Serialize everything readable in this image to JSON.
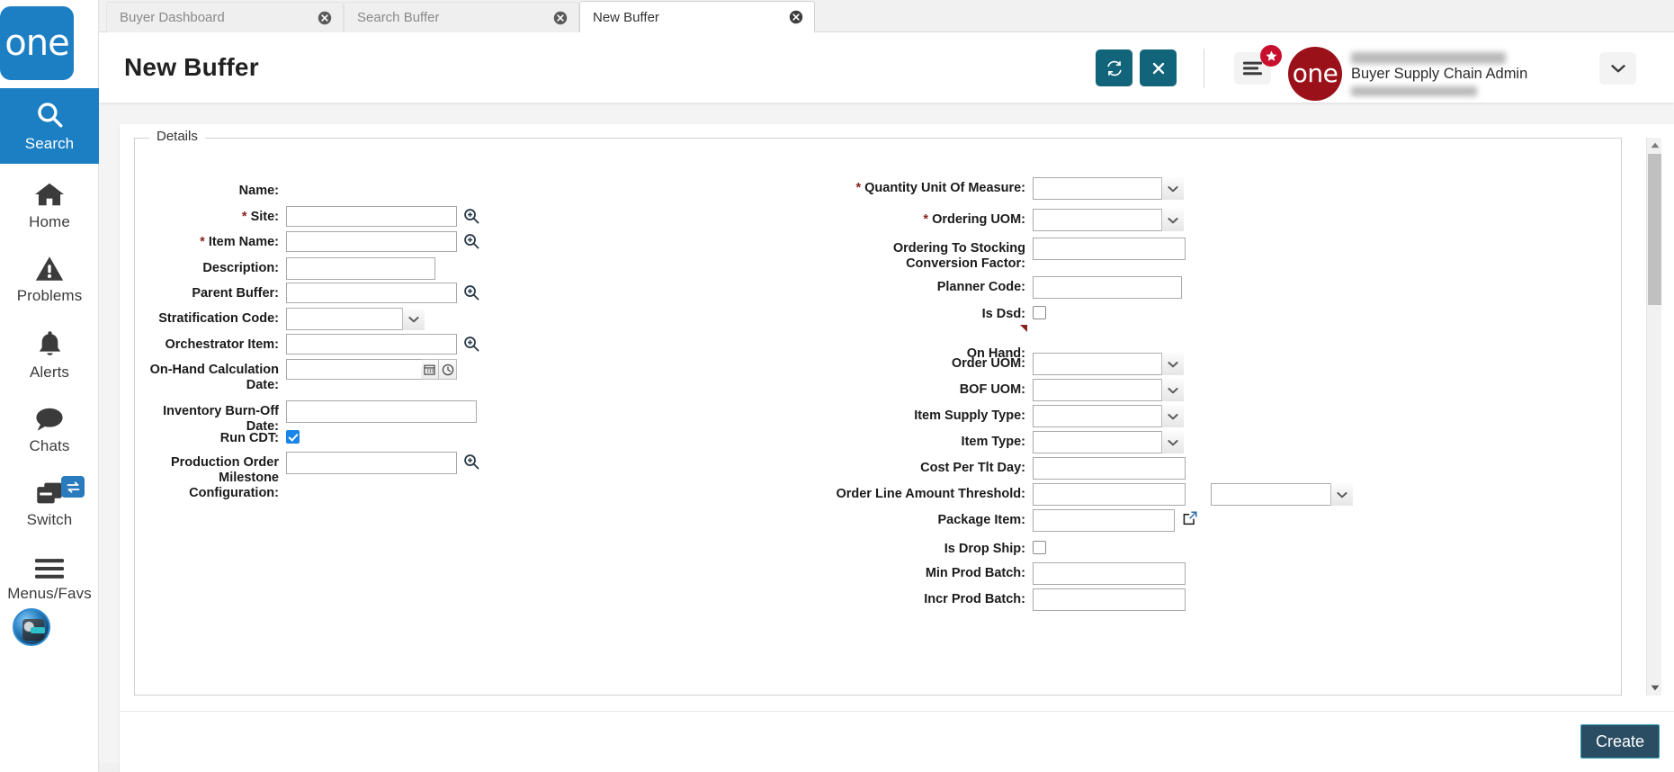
{
  "sidebar": {
    "logo_text": "one",
    "items": [
      {
        "label": "Search",
        "icon": "search-icon",
        "active": true
      },
      {
        "label": "Home",
        "icon": "home-icon",
        "active": false
      },
      {
        "label": "Problems",
        "icon": "warning-icon",
        "active": false
      },
      {
        "label": "Alerts",
        "icon": "bell-icon",
        "active": false
      },
      {
        "label": "Chats",
        "icon": "chat-icon",
        "active": false
      },
      {
        "label": "Switch",
        "icon": "switch-icon",
        "active": false
      },
      {
        "label": "Menus/Favs",
        "icon": "hamburger-icon",
        "active": false
      }
    ],
    "avatar_name": "user-avatar"
  },
  "tabs": [
    {
      "label": "Buyer Dashboard",
      "active": false,
      "closable": true
    },
    {
      "label": "Search Buffer",
      "active": false,
      "closable": true
    },
    {
      "label": "New Buffer",
      "active": true,
      "closable": true
    }
  ],
  "header": {
    "title": "New Buffer",
    "refresh_icon": "refresh-icon",
    "close_icon": "close-icon",
    "menu_icon": "hamburger-menu-icon",
    "badge_icon": "star-icon",
    "brand_text": "one",
    "user_role": "Buyer Supply Chain Admin",
    "caret_icon": "chevron-down-icon"
  },
  "details": {
    "legend": "Details",
    "left_fields": [
      {
        "label": "Name:",
        "required": false,
        "type": "text-only",
        "value": "",
        "name": "name"
      },
      {
        "label": "Site:",
        "required": true,
        "type": "lookup",
        "value": "",
        "name": "site"
      },
      {
        "label": "Item Name:",
        "required": true,
        "type": "lookup",
        "value": "",
        "name": "item-name"
      },
      {
        "label": "Description:",
        "required": false,
        "type": "text",
        "value": "",
        "name": "description"
      },
      {
        "label": "Parent Buffer:",
        "required": false,
        "type": "lookup",
        "value": "",
        "name": "parent-buffer"
      },
      {
        "label": "Stratification Code:",
        "required": false,
        "type": "select",
        "value": "",
        "name": "stratification-code"
      },
      {
        "label": "Orchestrator Item:",
        "required": false,
        "type": "lookup",
        "value": "",
        "name": "orchestrator-item"
      },
      {
        "label": "On-Hand Calculation\nDate:",
        "required": false,
        "type": "datetime",
        "value": "",
        "name": "on-hand-calculation-date"
      },
      {
        "label": "Inventory Burn-Off Date:",
        "required": false,
        "type": "text",
        "value": "",
        "name": "inventory-burn-off-date"
      },
      {
        "label": "Run CDT:",
        "required": false,
        "type": "checkbox",
        "value": true,
        "name": "run-cdt"
      },
      {
        "label": "Production Order\nMilestone Configuration:",
        "required": false,
        "type": "lookup",
        "value": "",
        "name": "production-order-milestone-configuration"
      }
    ],
    "right_fields": [
      {
        "label": "Quantity Unit Of Measure:",
        "required": true,
        "type": "select",
        "value": "",
        "name": "quantity-unit-of-measure"
      },
      {
        "label": "Ordering UOM:",
        "required": true,
        "type": "select",
        "value": "",
        "name": "ordering-uom"
      },
      {
        "label": "Ordering To Stocking\nConversion Factor:",
        "required": false,
        "type": "text",
        "value": "",
        "name": "ordering-to-stocking-conversion-factor"
      },
      {
        "label": "Planner Code:",
        "required": false,
        "type": "text",
        "value": "",
        "name": "planner-code"
      },
      {
        "label": "Is Dsd:",
        "required": false,
        "type": "checkbox",
        "value": false,
        "name": "is-dsd"
      },
      {
        "label": "On Hand:",
        "required": false,
        "type": "marked-label",
        "value": "",
        "name": "on-hand"
      },
      {
        "label": "Order UOM:",
        "required": false,
        "type": "select",
        "value": "",
        "name": "order-uom"
      },
      {
        "label": "BOF UOM:",
        "required": false,
        "type": "select",
        "value": "",
        "name": "bof-uom"
      },
      {
        "label": "Item Supply Type:",
        "required": false,
        "type": "select",
        "value": "",
        "name": "item-supply-type"
      },
      {
        "label": "Item Type:",
        "required": false,
        "type": "select",
        "value": "",
        "name": "item-type"
      },
      {
        "label": "Cost Per Tlt Day:",
        "required": false,
        "type": "text",
        "value": "",
        "name": "cost-per-tlt-day"
      },
      {
        "label": "Order Line Amount Threshold:",
        "required": false,
        "type": "text-select",
        "value": "",
        "name": "order-line-amount-threshold"
      },
      {
        "label": "Package Item:",
        "required": false,
        "type": "text-extlink",
        "value": "",
        "name": "package-item"
      },
      {
        "label": "Is Drop Ship:",
        "required": false,
        "type": "checkbox",
        "value": false,
        "name": "is-drop-ship"
      },
      {
        "label": "Min Prod Batch:",
        "required": false,
        "type": "text",
        "value": "",
        "name": "min-prod-batch"
      },
      {
        "label": "Incr Prod Batch:",
        "required": false,
        "type": "text",
        "value": "",
        "name": "incr-prod-batch"
      }
    ]
  },
  "footer": {
    "create_label": "Create"
  },
  "colors": {
    "sidebar_accent": "#1c7fc4",
    "header_button": "#11647a",
    "brand_red": "#9b1119",
    "badge_red": "#c8102e",
    "create_button": "#2b4d63",
    "required_star": "#8a1f1f",
    "checkbox_checked": "#1a85e8"
  }
}
